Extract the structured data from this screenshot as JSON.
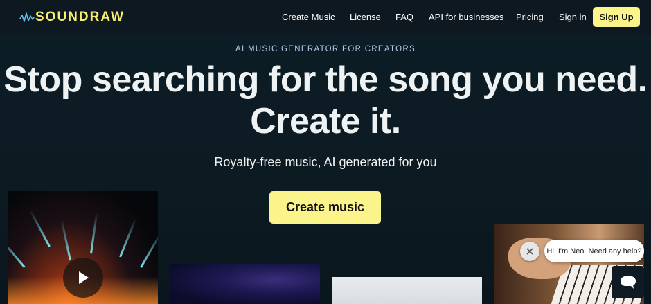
{
  "brand": {
    "name": "SOUNDRAW",
    "logo_icon": "wave-icon",
    "accent_color": "#fbf48a"
  },
  "nav": {
    "items": [
      {
        "label": "Create Music"
      },
      {
        "label": "License"
      },
      {
        "label": "FAQ"
      },
      {
        "label": "API for businesses"
      },
      {
        "label": "Pricing"
      },
      {
        "label": "Sign in"
      }
    ],
    "signup_label": "Sign Up"
  },
  "hero": {
    "eyebrow": "AI MUSIC GENERATOR FOR CREATORS",
    "headline_line1": "Stop searching for the song you need.",
    "headline_line2": "Create it.",
    "subheadline": "Royalty-free music, AI generated for you",
    "cta_label": "Create music"
  },
  "media": {
    "play_icon": "play-icon"
  },
  "chat": {
    "message": "Hi, I'm Neo. Need any help?",
    "close_icon": "close-icon",
    "launcher_icon": "chat-icon"
  }
}
